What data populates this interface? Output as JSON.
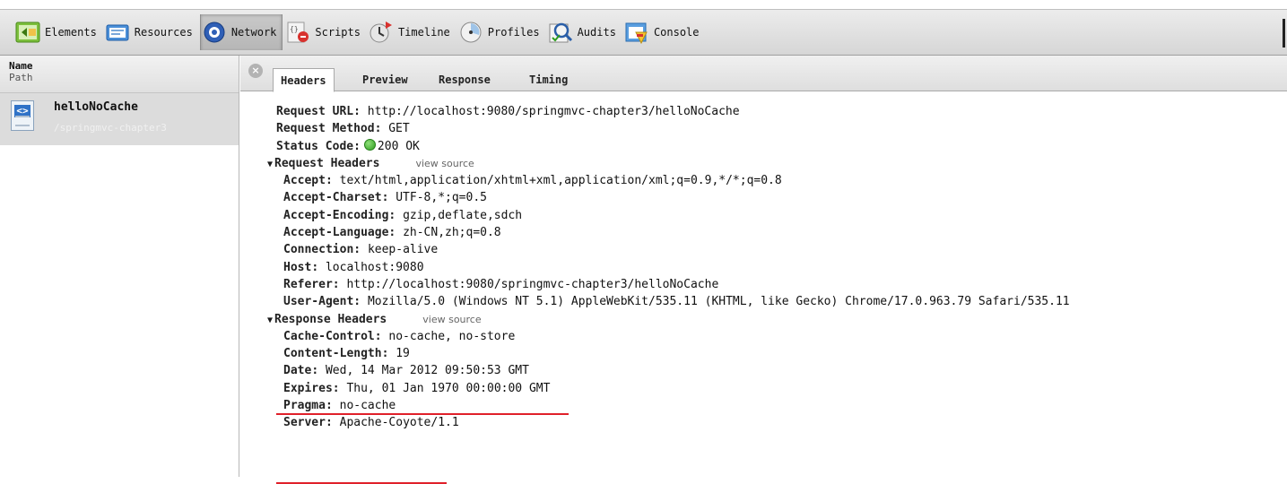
{
  "toolbar": {
    "items": [
      {
        "label": "Elements",
        "icon": "elements-icon"
      },
      {
        "label": "Resources",
        "icon": "resources-icon"
      },
      {
        "label": "Network",
        "icon": "network-icon",
        "active": true
      },
      {
        "label": "Scripts",
        "icon": "scripts-icon"
      },
      {
        "label": "Timeline",
        "icon": "timeline-icon"
      },
      {
        "label": "Profiles",
        "icon": "profiles-icon"
      },
      {
        "label": "Audits",
        "icon": "audits-icon"
      },
      {
        "label": "Console",
        "icon": "console-icon"
      }
    ]
  },
  "sidebar": {
    "header_name": "Name",
    "header_path": "Path",
    "request": {
      "name": "helloNoCache",
      "path": "/springmvc-chapter3",
      "icon_text": "<>"
    }
  },
  "detail": {
    "tabs": [
      "Headers",
      "Preview",
      "Response",
      "Timing"
    ],
    "selected_tab": "Headers",
    "close_glyph": "×",
    "general": {
      "request_url_key": "Request URL",
      "request_url": "http://localhost:9080/springmvc-chapter3/helloNoCache",
      "request_method_key": "Request Method",
      "request_method": "GET",
      "status_code_key": "Status Code",
      "status_code": "200 OK"
    },
    "request_headers": {
      "title": "Request Headers",
      "view_source": "view source",
      "items": [
        {
          "key": "Accept",
          "value": "text/html,application/xhtml+xml,application/xml;q=0.9,*/*;q=0.8"
        },
        {
          "key": "Accept-Charset",
          "value": "UTF-8,*;q=0.5"
        },
        {
          "key": "Accept-Encoding",
          "value": "gzip,deflate,sdch"
        },
        {
          "key": "Accept-Language",
          "value": "zh-CN,zh;q=0.8"
        },
        {
          "key": "Connection",
          "value": "keep-alive"
        },
        {
          "key": "Host",
          "value": "localhost:9080"
        },
        {
          "key": "Referer",
          "value": "http://localhost:9080/springmvc-chapter3/helloNoCache"
        },
        {
          "key": "User-Agent",
          "value": "Mozilla/5.0 (Windows NT 5.1) AppleWebKit/535.11 (KHTML, like Gecko) Chrome/17.0.963.79 Safari/535.11"
        }
      ]
    },
    "response_headers": {
      "title": "Response Headers",
      "view_source": "view source",
      "items": [
        {
          "key": "Cache-Control",
          "value": "no-cache, no-store"
        },
        {
          "key": "Content-Length",
          "value": "19"
        },
        {
          "key": "Date",
          "value": "Wed, 14 Mar 2012 09:50:53 GMT"
        },
        {
          "key": "Expires",
          "value": "Thu, 01 Jan 1970 00:00:00 GMT"
        },
        {
          "key": "Pragma",
          "value": "no-cache"
        },
        {
          "key": "Server",
          "value": "Apache-Coyote/1.1"
        }
      ]
    },
    "colors": {
      "status_ok": "#2e9d1f",
      "annotation_underline": "#e0202a"
    }
  }
}
